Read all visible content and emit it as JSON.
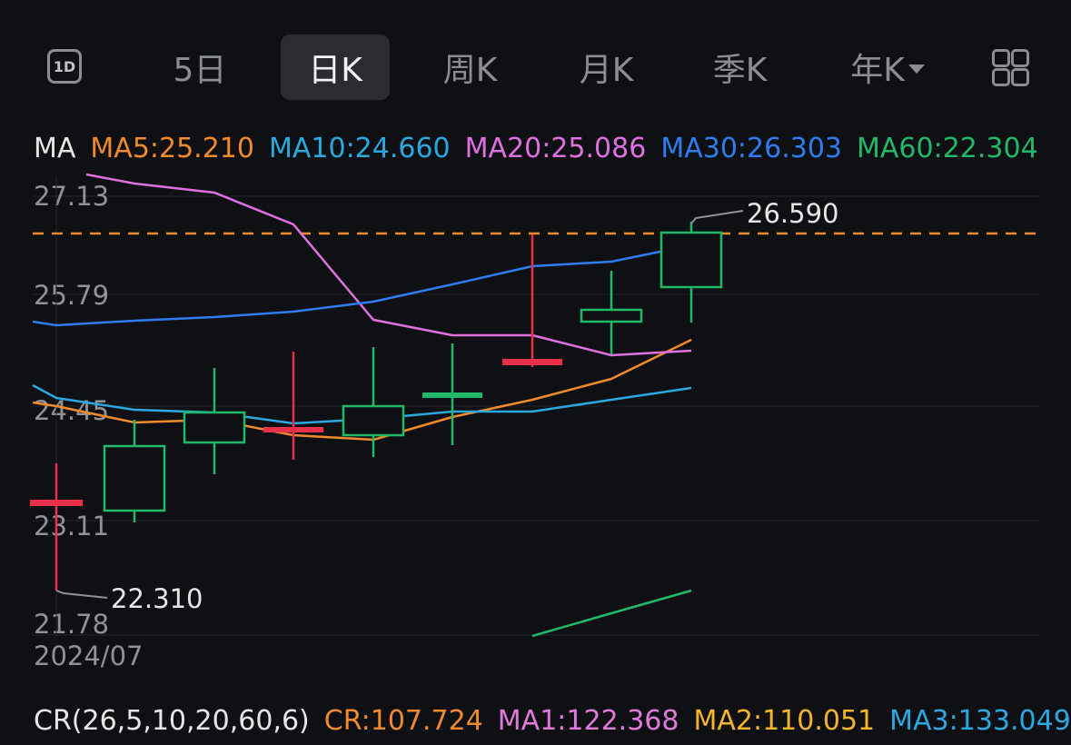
{
  "tabs": [
    {
      "label": "5日",
      "active": false
    },
    {
      "label": "日K",
      "active": true
    },
    {
      "label": "周K",
      "active": false
    },
    {
      "label": "月K",
      "active": false
    },
    {
      "label": "季K",
      "active": false
    },
    {
      "label": "年K",
      "active": false
    }
  ],
  "icons": {
    "period": "1D",
    "period_icon": "1d-icon",
    "grid_icon": "grid-icon",
    "dropdown_icon": "caret-down-icon"
  },
  "ma_legend": {
    "label": "MA",
    "items": [
      {
        "text": "MA5:25.210",
        "color": "#f08a2c"
      },
      {
        "text": "MA10:24.660",
        "color": "#2aa8e0"
      },
      {
        "text": "MA20:25.086",
        "color": "#e070e0"
      },
      {
        "text": "MA30:26.303",
        "color": "#2f7cf0"
      },
      {
        "text": "MA60:22.304",
        "color": "#21b86a"
      }
    ]
  },
  "cr_legend": {
    "label": "CR(26,5,10,20,60,6)",
    "items": [
      {
        "text": "CR:107.724",
        "color": "#f08a2c"
      },
      {
        "text": "MA1:122.368",
        "color": "#e07ad8"
      },
      {
        "text": "MA2:110.051",
        "color": "#f5b52a"
      },
      {
        "text": "MA3:133.049",
        "color": "#2aa8e0"
      }
    ]
  },
  "chart_data": {
    "type": "candlestick",
    "y_ticks": [
      "27.13",
      "25.79",
      "24.45",
      "23.11",
      "21.78"
    ],
    "ylim": [
      21.78,
      27.13
    ],
    "x_label": "2024/07",
    "high_label": "26.590",
    "low_label": "22.310",
    "reference_line": 26.59,
    "up_color": "#21b86a",
    "down_color": "#e8304a",
    "candles": [
      {
        "open": 23.11,
        "close": 23.11,
        "high": 23.59,
        "low": 22.31
      },
      {
        "open": 23.0,
        "close": 23.73,
        "high": 24.05,
        "low": 22.88
      },
      {
        "open": 24.05,
        "close": 24.41,
        "high": 24.86,
        "low": 23.7
      },
      {
        "open": 24.25,
        "close": 24.25,
        "high": 24.99,
        "low": 23.64
      },
      {
        "open": 24.14,
        "close": 24.48,
        "high": 25.1,
        "low": 23.67
      },
      {
        "open": 24.6,
        "close": 24.6,
        "high": 25.13,
        "low": 23.95
      },
      {
        "open": 25.15,
        "close": 25.15,
        "high": 26.59,
        "low": 25.13
      },
      {
        "open": 25.5,
        "close": 25.65,
        "high": 26.0,
        "low": 25.3
      },
      {
        "open": 25.85,
        "close": 26.59,
        "high": 26.71,
        "low": 25.5
      }
    ],
    "series": [
      {
        "name": "MA5",
        "color": "#f08a2c",
        "values": [
          24.45,
          24.31,
          24.33,
          24.19,
          24.17,
          24.48,
          24.67,
          24.9,
          25.21
        ]
      },
      {
        "name": "MA10",
        "color": "#2aa8e0",
        "values": [
          24.54,
          24.49,
          24.49,
          24.35,
          24.39,
          24.49,
          24.5,
          24.58,
          24.66
        ]
      },
      {
        "name": "MA20",
        "color": "#e070e0",
        "values": [
          26.99,
          26.8,
          26.69,
          26.22,
          25.56,
          25.38,
          25.38,
          25.12,
          25.09
        ]
      },
      {
        "name": "MA30",
        "color": "#2f7cf0",
        "values": [
          25.4,
          25.43,
          25.45,
          25.5,
          25.6,
          25.77,
          25.96,
          26.0,
          26.3
        ]
      },
      {
        "name": "MA60",
        "color": "#21b86a",
        "values": [
          null,
          null,
          null,
          null,
          null,
          21.78,
          21.89,
          22.0,
          22.3
        ]
      }
    ]
  }
}
